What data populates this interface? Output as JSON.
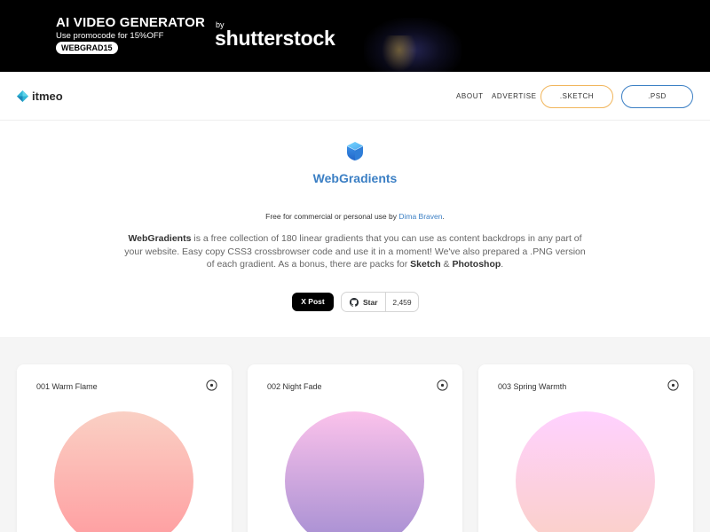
{
  "banner": {
    "title": "AI VIDEO GENERATOR",
    "promo": "Use promocode for 15%OFF",
    "code": "WEBGRAD15",
    "by": "by",
    "brand": "shutterstock"
  },
  "header": {
    "logo_text": "itmeo",
    "nav": [
      "ABOUT",
      "ADVERTISE"
    ],
    "sketch_label": ".SKETCH",
    "psd_label": ".PSD",
    "accent_sketch": "#f1b55b",
    "accent_psd": "#3b7fc4"
  },
  "hero": {
    "title": "WebGradients",
    "free_prefix": "Free for commercial or personal use by ",
    "author": "Dima Braven",
    "free_suffix": ".",
    "desc_brand": "WebGradients",
    "desc_text": " is a free collection of 180 linear gradients that you can use as content backdrops in any part of your website. Easy copy CSS3 crossbrowser code and use it in a moment! We've also prepared a .PNG version of each gradient. As a bonus, there are packs for ",
    "desc_sketch": "Sketch",
    "desc_amp": " & ",
    "desc_photoshop": "Photoshop",
    "desc_end": ".",
    "post_label": "X Post",
    "star_label": "Star",
    "star_count": "2,459"
  },
  "gradients": [
    {
      "name": "001 Warm Flame",
      "from": "#ff9a9e",
      "to": "#fad0c4",
      "icon": "add-circle-icon"
    },
    {
      "name": "002 Night Fade",
      "from": "#a18cd1",
      "to": "#fbc2eb",
      "icon": "add-circle-icon"
    },
    {
      "name": "003 Spring Warmth",
      "from": "#fad0c4",
      "to": "#ffd1ff",
      "icon": "add-circle-icon"
    }
  ]
}
